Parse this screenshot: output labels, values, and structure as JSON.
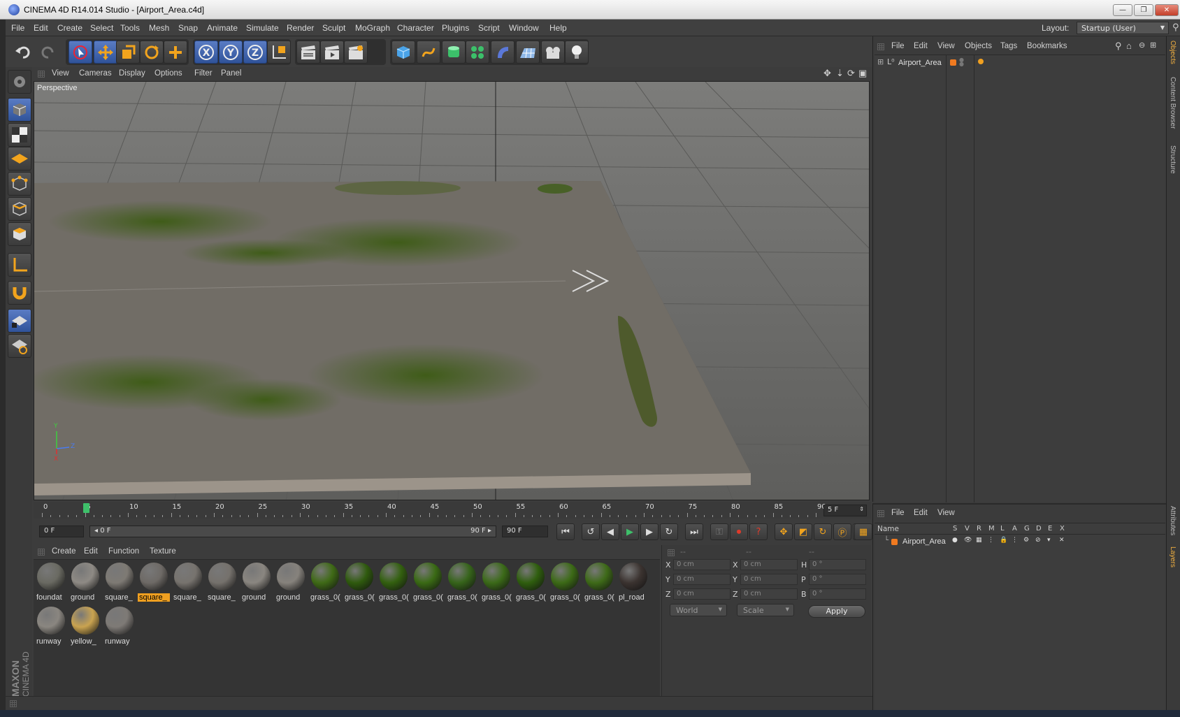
{
  "window": {
    "title": "CINEMA 4D R14.014 Studio - [Airport_Area.c4d]",
    "min": "—",
    "max": "❐",
    "close": "✕"
  },
  "menubar": {
    "items": [
      "File",
      "Edit",
      "Create",
      "Select",
      "Tools",
      "Mesh",
      "Snap",
      "Animate",
      "Simulate",
      "Render",
      "Sculpt",
      "MoGraph",
      "Character",
      "Plugins",
      "Script",
      "Window",
      "Help"
    ],
    "layout_label": "Layout:",
    "layout_value": "Startup (User)"
  },
  "viewport": {
    "menu": [
      "View",
      "Cameras",
      "Display",
      "Options",
      "Filter",
      "Panel"
    ],
    "camera_label": "Perspective",
    "axis_y": "Y",
    "axis_z": "Z",
    "axis_x": "X"
  },
  "timeline": {
    "ticks": [
      "0",
      "5",
      "10",
      "15",
      "20",
      "25",
      "30",
      "35",
      "40",
      "45",
      "50",
      "55",
      "60",
      "65",
      "70",
      "75",
      "80",
      "85",
      "90"
    ],
    "current_frame_box": "5 F",
    "playhead_frame": 5,
    "max_frame": 90
  },
  "transport": {
    "start": "0 F",
    "range_start": "◂ 0 F",
    "range_end": "90 F ▸",
    "end": "90 F"
  },
  "materials": {
    "menu": [
      "Create",
      "Edit",
      "Function",
      "Texture"
    ],
    "items": [
      {
        "label": "foundat",
        "color": "#6a6a62"
      },
      {
        "label": "ground",
        "color": "#8e8a84"
      },
      {
        "label": "square_",
        "color": "#7e7a74"
      },
      {
        "label": "square_",
        "color": "#6e6a66",
        "selected": true
      },
      {
        "label": "square_",
        "color": "#77736e"
      },
      {
        "label": "square_",
        "color": "#75716c"
      },
      {
        "label": "ground",
        "color": "#8a8680"
      },
      {
        "label": "ground",
        "color": "#86827c"
      },
      {
        "label": "grass_0(",
        "color": "#3f6a16"
      },
      {
        "label": "grass_0(",
        "color": "#2f5a0e"
      },
      {
        "label": "grass_0(",
        "color": "#33600f"
      },
      {
        "label": "grass_0(",
        "color": "#3a6a14"
      },
      {
        "label": "grass_0(",
        "color": "#36641a"
      },
      {
        "label": "grass_0(",
        "color": "#3b6a18"
      },
      {
        "label": "grass_0(",
        "color": "#2f5e0e"
      },
      {
        "label": "grass_0(",
        "color": "#3c6a16"
      },
      {
        "label": "grass_0(",
        "color": "#3e6a18"
      },
      {
        "label": "pl_road",
        "color": "#3b3330"
      },
      {
        "label": "runway",
        "color": "#8a8680"
      },
      {
        "label": "yellow_",
        "color": "#c9a350"
      },
      {
        "label": "runway",
        "color": "#7e7a76"
      }
    ]
  },
  "coords": {
    "headers": [
      "--",
      "--",
      "--"
    ],
    "rows": [
      {
        "a": "X",
        "av": "0 cm",
        "b": "X",
        "bv": "0 cm",
        "c": "H",
        "cv": "0 °"
      },
      {
        "a": "Y",
        "av": "0 cm",
        "b": "Y",
        "bv": "0 cm",
        "c": "P",
        "cv": "0 °"
      },
      {
        "a": "Z",
        "av": "0 cm",
        "b": "Z",
        "bv": "0 cm",
        "c": "B",
        "cv": "0 °"
      }
    ],
    "mode": "World",
    "scale": "Scale",
    "apply": "Apply"
  },
  "objects": {
    "menu": [
      "File",
      "Edit",
      "View",
      "Objects",
      "Tags",
      "Bookmarks"
    ],
    "root": "Airport_Area"
  },
  "layers": {
    "menu": [
      "File",
      "Edit",
      "View"
    ],
    "name_header": "Name",
    "cols": [
      "S",
      "V",
      "R",
      "M",
      "L",
      "A",
      "G",
      "D",
      "E",
      "X"
    ],
    "row": "Airport_Area"
  },
  "sidetabs": {
    "right_top": [
      "Objects",
      "Content Browser",
      "Structure"
    ],
    "right_bottom": [
      "Attributes",
      "Layers"
    ]
  },
  "brand": {
    "maxon": "MAXON",
    "cinema": "CINEMA 4D"
  },
  "colors": {
    "accent": "#f0a020",
    "active_blue": "#3f64b5"
  }
}
